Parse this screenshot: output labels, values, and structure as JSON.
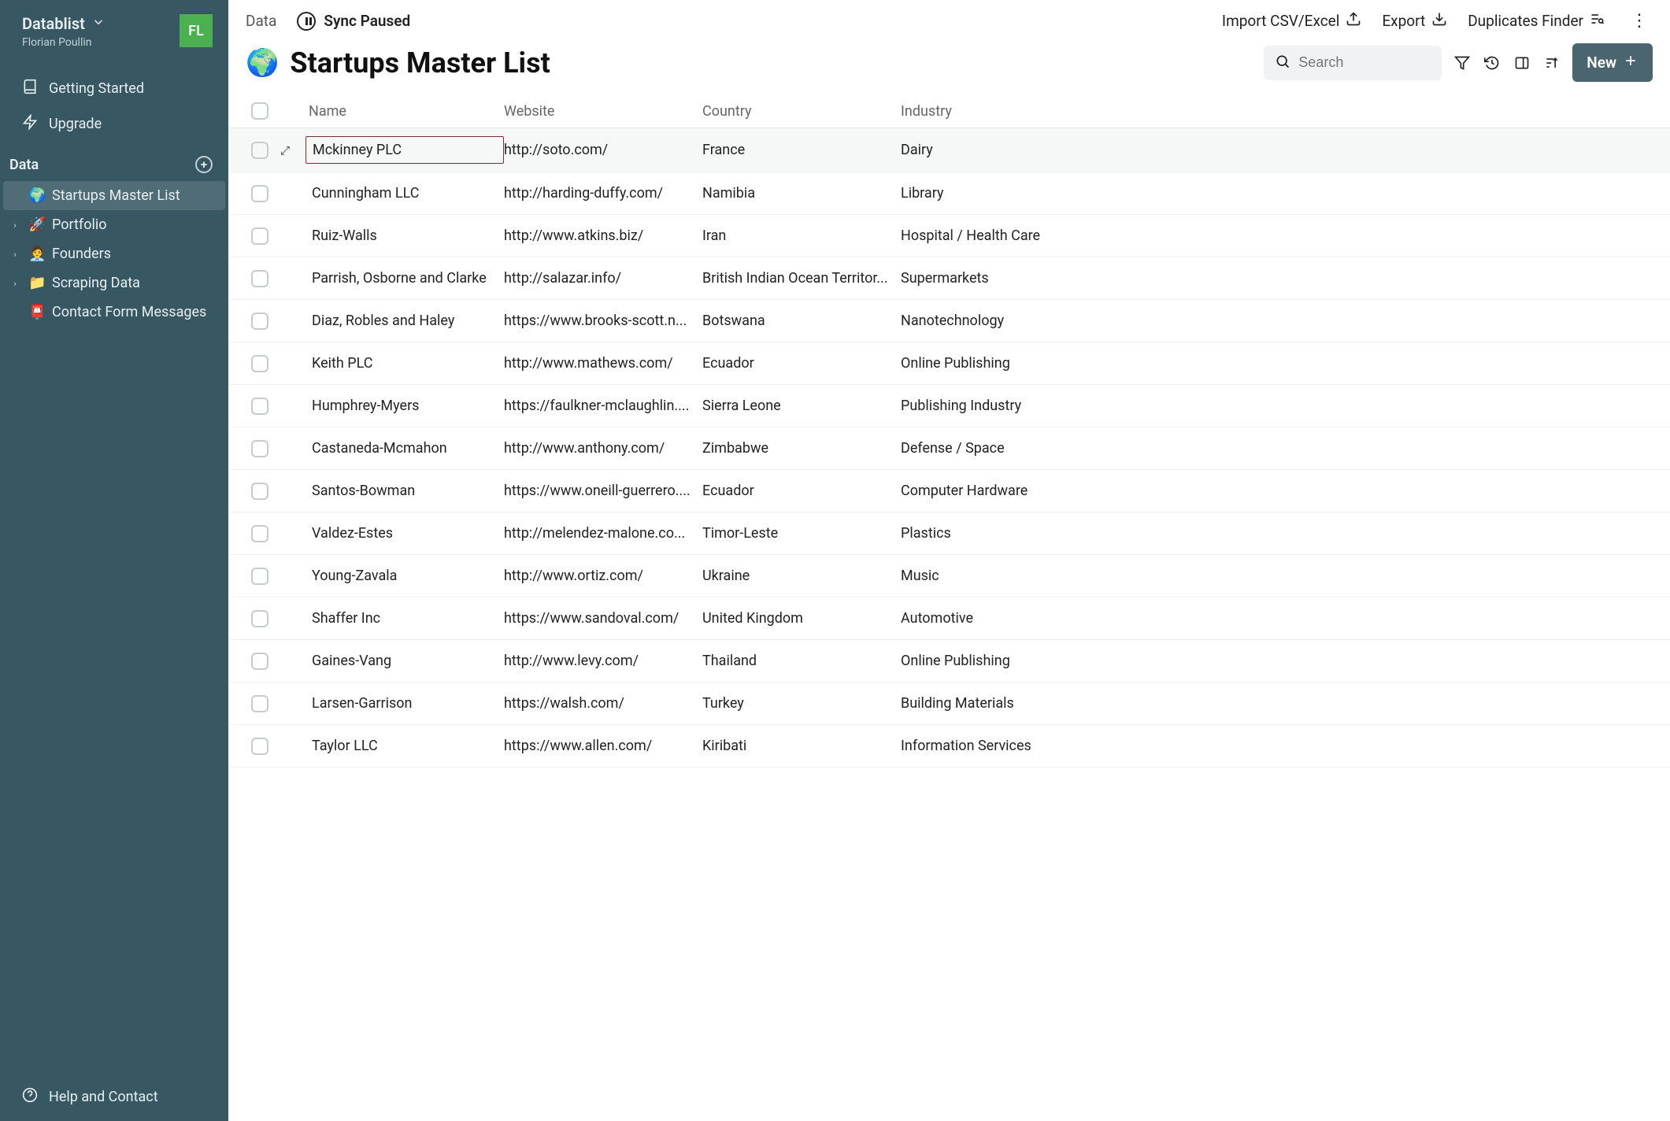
{
  "sidebar": {
    "workspace_name": "Datablist",
    "user_name": "Florian Poullin",
    "avatar_initials": "FL",
    "nav": {
      "getting_started": "Getting Started",
      "upgrade": "Upgrade"
    },
    "section_label": "Data",
    "tree": [
      {
        "icon": "🌍",
        "label": "Startups Master List",
        "active": true,
        "has_children": false
      },
      {
        "icon": "🚀",
        "label": "Portfolio",
        "active": false,
        "has_children": true
      },
      {
        "icon": "🧑‍💼",
        "label": "Founders",
        "active": false,
        "has_children": true
      },
      {
        "icon": "📁",
        "label": "Scraping Data",
        "active": false,
        "has_children": true
      },
      {
        "icon": "📮",
        "label": "Contact Form Messages",
        "active": false,
        "has_children": false
      }
    ],
    "help": "Help and Contact"
  },
  "topbar": {
    "breadcrumb": "Data",
    "sync_label": "Sync Paused",
    "import_label": "Import CSV/Excel",
    "export_label": "Export",
    "dup_label": "Duplicates Finder"
  },
  "title": {
    "emoji": "🌍",
    "text": "Startups Master List",
    "search_placeholder": "Search",
    "new_btn": "New"
  },
  "columns": {
    "name": "Name",
    "website": "Website",
    "country": "Country",
    "industry": "Industry"
  },
  "rows": [
    {
      "name": "Mckinney PLC",
      "website": "http://soto.com/",
      "country": "France",
      "industry": "Dairy",
      "selected": true
    },
    {
      "name": "Cunningham LLC",
      "website": "http://harding-duffy.com/",
      "country": "Namibia",
      "industry": "Library"
    },
    {
      "name": "Ruiz-Walls",
      "website": "http://www.atkins.biz/",
      "country": "Iran",
      "industry": "Hospital / Health Care"
    },
    {
      "name": "Parrish, Osborne and Clarke",
      "website": "http://salazar.info/",
      "country": "British Indian Ocean Territor...",
      "industry": "Supermarkets"
    },
    {
      "name": "Diaz, Robles and Haley",
      "website": "https://www.brooks-scott.n...",
      "country": "Botswana",
      "industry": "Nanotechnology"
    },
    {
      "name": "Keith PLC",
      "website": "http://www.mathews.com/",
      "country": "Ecuador",
      "industry": "Online Publishing"
    },
    {
      "name": "Humphrey-Myers",
      "website": "https://faulkner-mclaughlin....",
      "country": "Sierra Leone",
      "industry": "Publishing Industry"
    },
    {
      "name": "Castaneda-Mcmahon",
      "website": "http://www.anthony.com/",
      "country": "Zimbabwe",
      "industry": "Defense / Space"
    },
    {
      "name": "Santos-Bowman",
      "website": "https://www.oneill-guerrero....",
      "country": "Ecuador",
      "industry": "Computer Hardware"
    },
    {
      "name": "Valdez-Estes",
      "website": "http://melendez-malone.co...",
      "country": "Timor-Leste",
      "industry": "Plastics"
    },
    {
      "name": "Young-Zavala",
      "website": "http://www.ortiz.com/",
      "country": "Ukraine",
      "industry": "Music"
    },
    {
      "name": "Shaffer Inc",
      "website": "https://www.sandoval.com/",
      "country": "United Kingdom",
      "industry": "Automotive"
    },
    {
      "name": "Gaines-Vang",
      "website": "http://www.levy.com/",
      "country": "Thailand",
      "industry": "Online Publishing"
    },
    {
      "name": "Larsen-Garrison",
      "website": "https://walsh.com/",
      "country": "Turkey",
      "industry": "Building Materials"
    },
    {
      "name": "Taylor LLC",
      "website": "https://www.allen.com/",
      "country": "Kiribati",
      "industry": "Information Services"
    }
  ]
}
